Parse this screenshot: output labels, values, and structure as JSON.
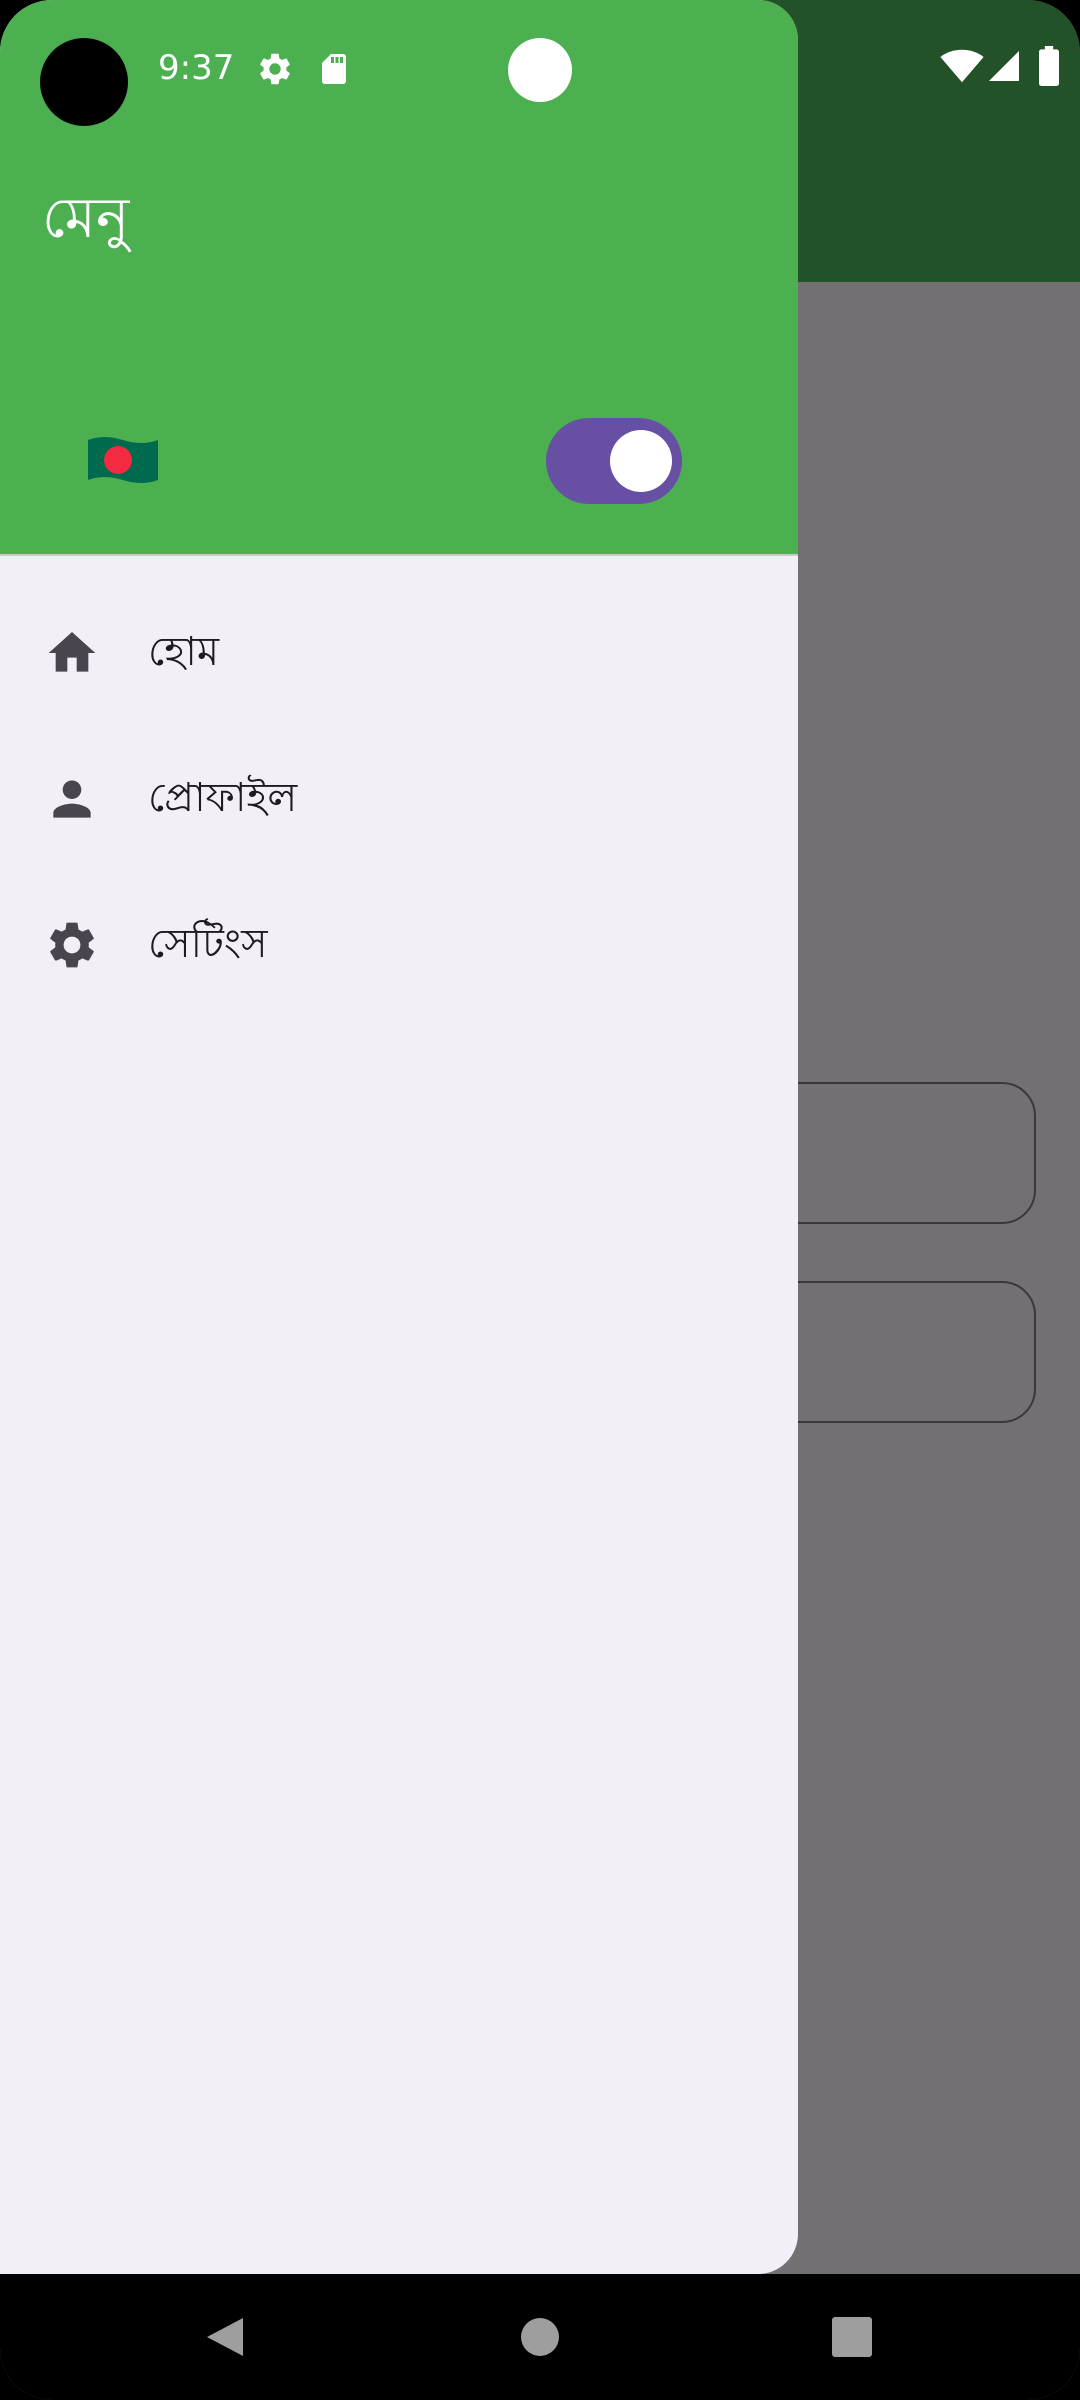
{
  "status_bar": {
    "time": "9:37"
  },
  "drawer": {
    "title": "মেনু",
    "flag_icon": "bangladesh-flag",
    "toggle_on": true,
    "items": [
      {
        "icon": "home-icon",
        "label": "হোম"
      },
      {
        "icon": "person-icon",
        "label": "প্রোফাইল"
      },
      {
        "icon": "settings-icon",
        "label": "সেটিংস"
      }
    ]
  },
  "colors": {
    "header": "#4caf50",
    "app_bar": "#245228",
    "scrim": "#736f73",
    "drawer_bg": "#f4eff7",
    "toggle": "#6750a4"
  }
}
